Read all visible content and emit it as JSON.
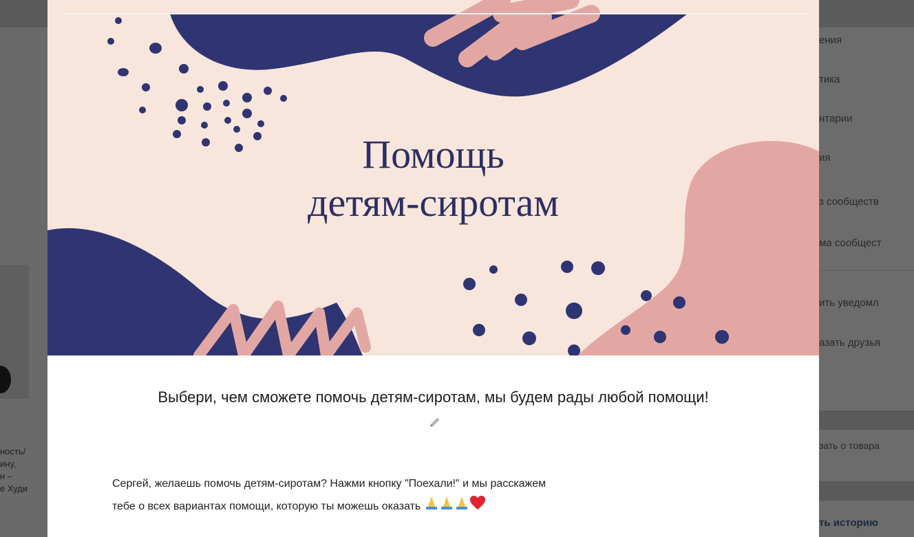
{
  "background": {
    "left_text_lines": [
      "ность/",
      "ину,",
      "н –",
      "е Худи"
    ],
    "right_menu": [
      "ения",
      "тика",
      "нтарии",
      "ия",
      "з сообществ",
      "ма сообщест",
      "ить уведомл",
      "азать друзья",
      "зать о товара",
      "ть историю"
    ]
  },
  "banner": {
    "title_line1": "Помощь",
    "title_line2": "детям-сиротам",
    "colors": {
      "cream": "#f8e6dc",
      "navy": "#2f3472",
      "pink": "#e3a7a3"
    }
  },
  "headline": "Выбери, чем сможете помочь детям-сиротам, мы будем рады любой помощи!",
  "description": {
    "line1": "Сергей, желаешь помочь детям-сиротам? Нажми кнопку \"Поехали!\" и мы расскажем",
    "line2": "тебе о всех вариантах помощи, которую ты можешь оказать"
  },
  "icons": {
    "edit": "pencil-icon",
    "emojis": [
      "folded-hands-icon",
      "folded-hands-icon",
      "folded-hands-icon",
      "red-heart-icon"
    ]
  }
}
